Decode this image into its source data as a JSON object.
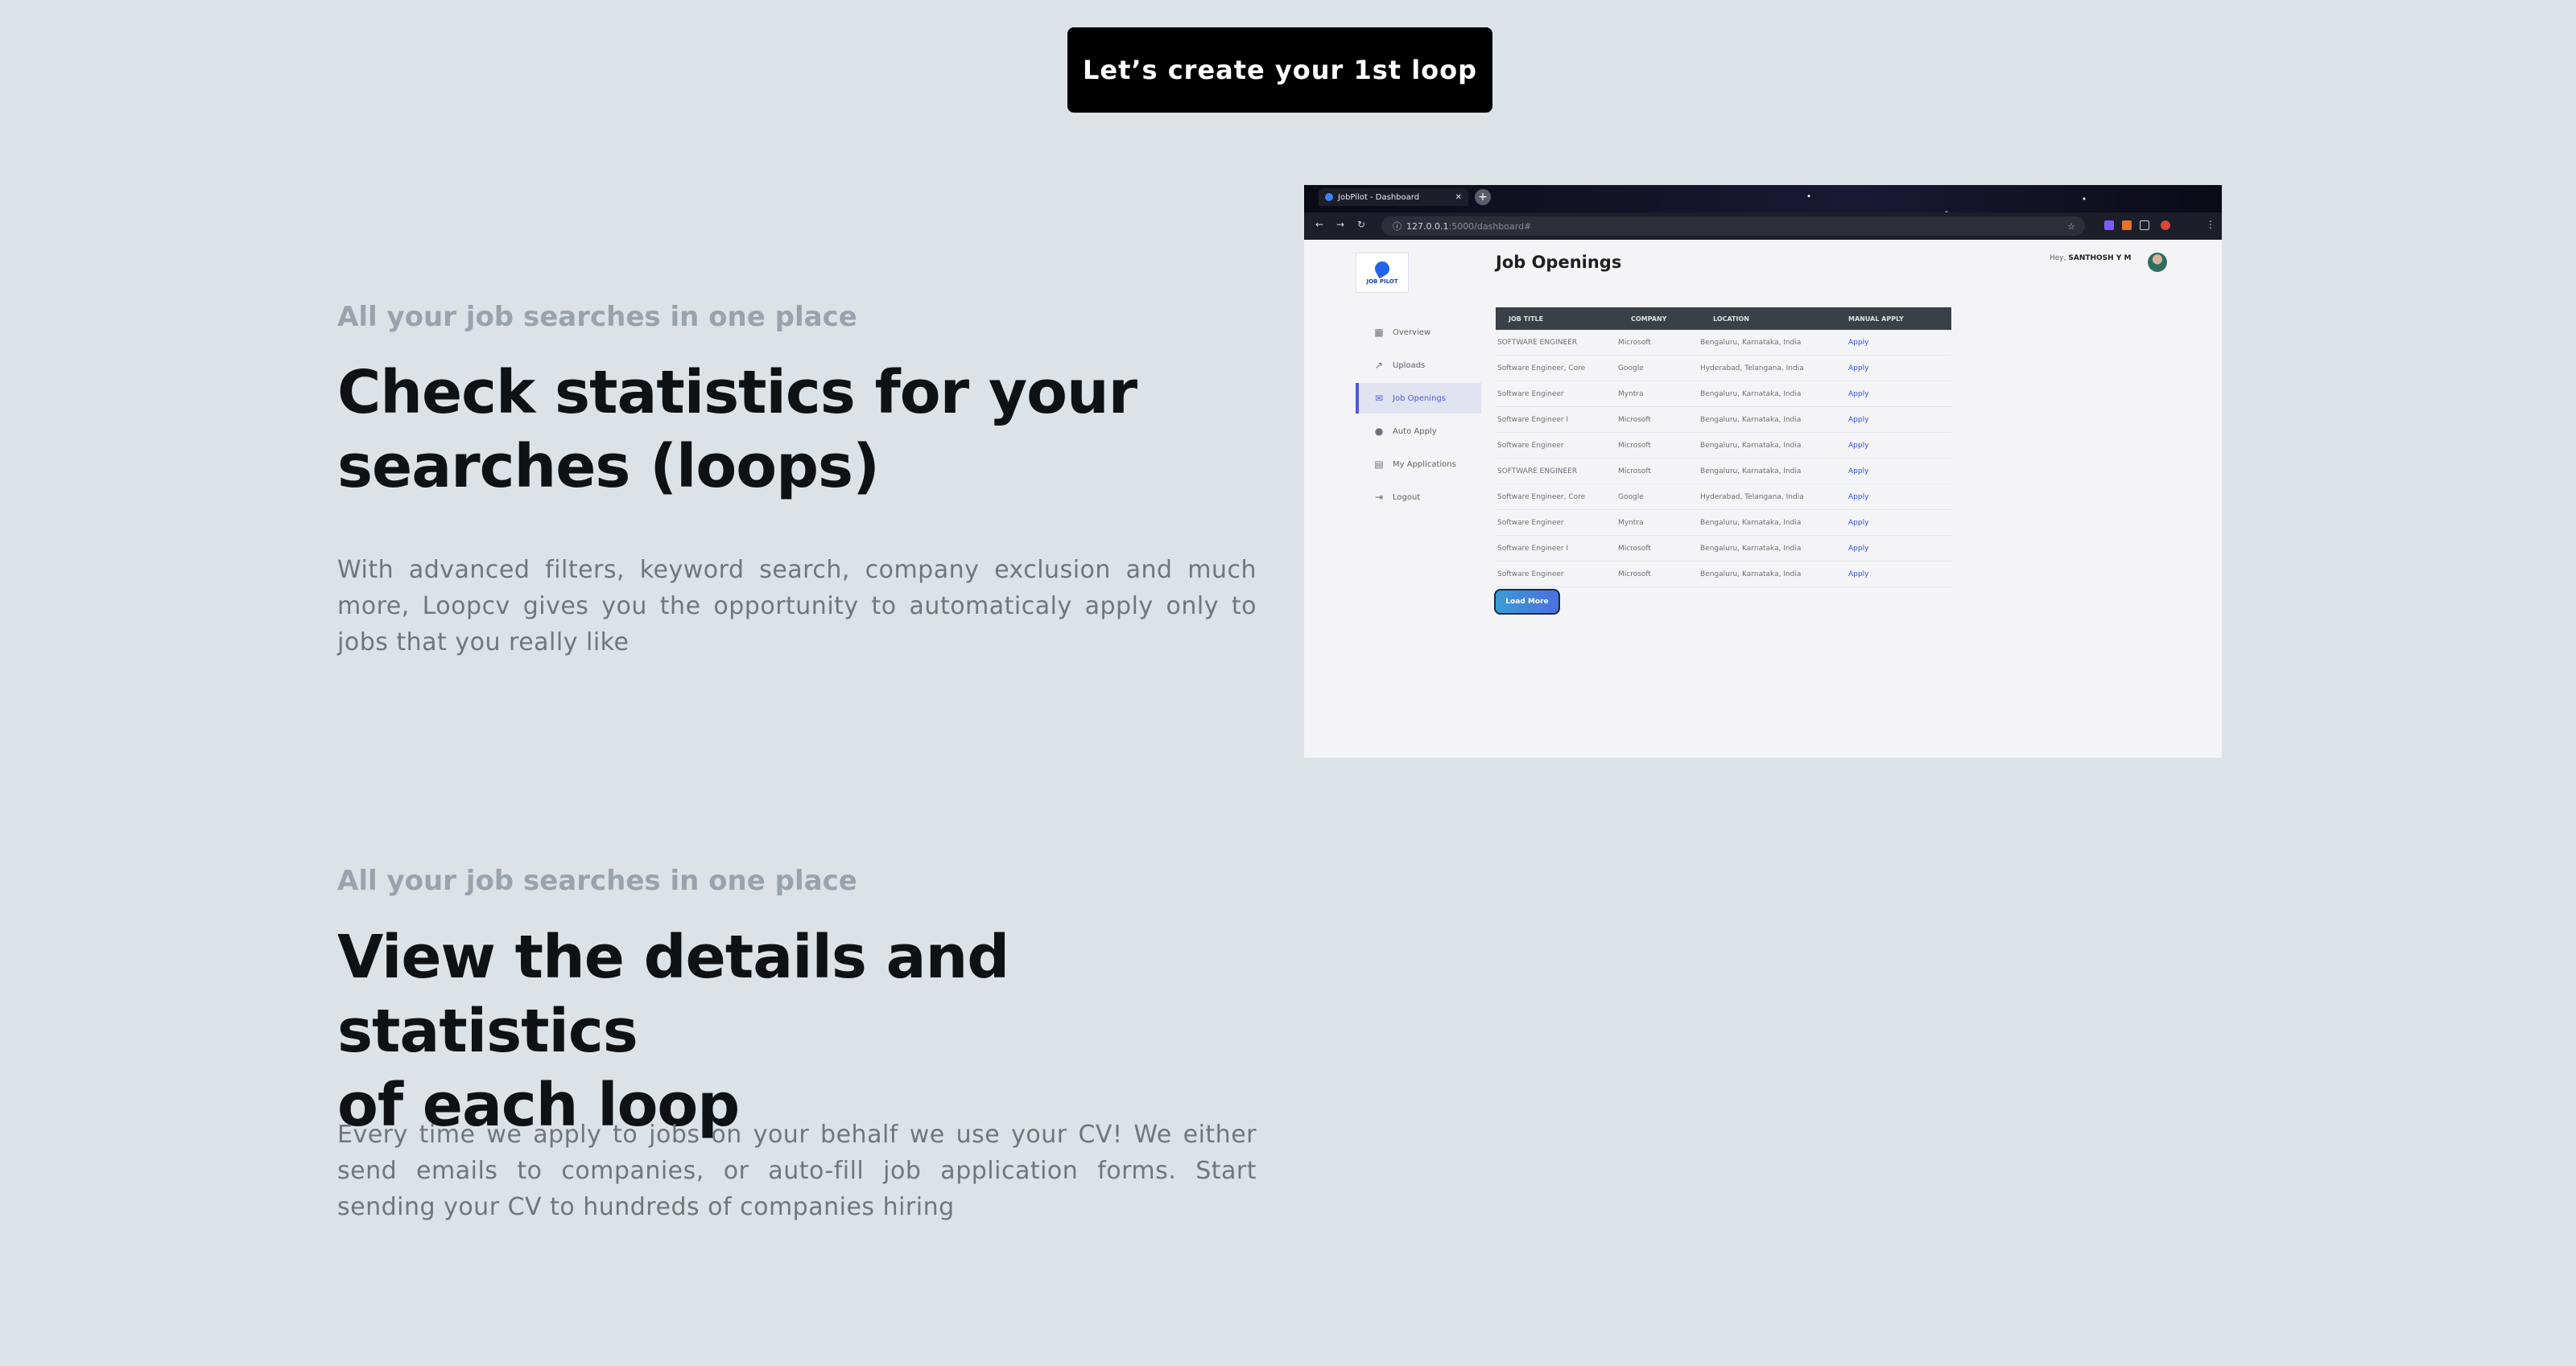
{
  "cta": {
    "label": "Let’s create your 1st loop"
  },
  "section1": {
    "eyebrow": "All your job searches in one place",
    "headline_line1": "Check statistics for your",
    "headline_line2": "searches (loops)",
    "paragraph": "With advanced filters, keyword search, company exclusion and much more, Loopcv gives you the opportunity to automaticaly apply only to jobs that you really like"
  },
  "section2": {
    "eyebrow": "All your job searches in one place",
    "headline_line1": "View the details and statistics",
    "headline_line2": "of each loop",
    "paragraph": "Every time we apply to jobs on your behalf we use your CV! We either send emails to companies, or auto-fill job application forms. Start sending your CV to hundreds of companies hiring"
  },
  "screenshot": {
    "tab_title": "JobPilot - Dashboard",
    "url_host": "127.0.0.1",
    "url_rest": ":5000/dashboard#",
    "logo_text": "JOB PILOT",
    "sidebar": [
      {
        "label": "Overview",
        "icon": "grid-icon"
      },
      {
        "label": "Uploads",
        "icon": "trend-icon"
      },
      {
        "label": "Job Openings",
        "icon": "mail-icon",
        "active": true
      },
      {
        "label": "Auto Apply",
        "icon": "user-icon"
      },
      {
        "label": "My Applications",
        "icon": "archive-icon"
      },
      {
        "label": "Logout",
        "icon": "logout-icon"
      }
    ],
    "page_title": "Job Openings",
    "greeting_prefix": "Hey,",
    "greeting_name": "SANTHOSH Y M",
    "columns": [
      "JOB TITLE",
      "COMPANY",
      "LOCATION",
      "MANUAL APPLY"
    ],
    "rows": [
      [
        "SOFTWARE ENGINEER",
        "Microsoft",
        "Bengaluru, Karnataka, India",
        "Apply"
      ],
      [
        "Software Engineer, Core",
        "Google",
        "Hyderabad, Telangana, India",
        "Apply"
      ],
      [
        "Software Engineer",
        "Myntra",
        "Bengaluru, Karnataka, India",
        "Apply"
      ],
      [
        "Software Engineer I",
        "Microsoft",
        "Bengaluru, Karnataka, India",
        "Apply"
      ],
      [
        "Software Engineer",
        "Microsoft",
        "Bengaluru, Karnataka, India",
        "Apply"
      ],
      [
        "SOFTWARE ENGINEER",
        "Microsoft",
        "Bengaluru, Karnataka, India",
        "Apply"
      ],
      [
        "Software Engineer, Core",
        "Google",
        "Hyderabad, Telangana, India",
        "Apply"
      ],
      [
        "Software Engineer",
        "Myntra",
        "Bengaluru, Karnataka, India",
        "Apply"
      ],
      [
        "Software Engineer I",
        "Microsoft",
        "Bengaluru, Karnataka, India",
        "Apply"
      ],
      [
        "Software Engineer",
        "Microsoft",
        "Bengaluru, Karnataka, India",
        "Apply"
      ]
    ],
    "load_more": "Load More"
  }
}
